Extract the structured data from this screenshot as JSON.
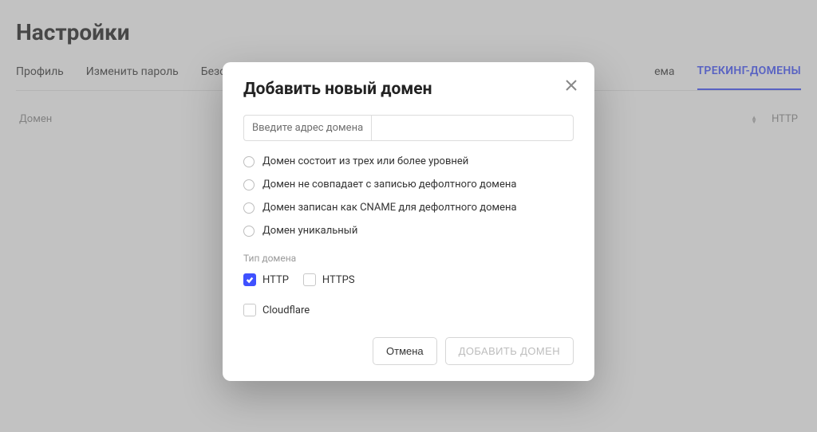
{
  "page": {
    "title": "Настройки"
  },
  "tabs": [
    "Профиль",
    "Изменить пароль",
    "Безопасность",
    "ема",
    "ТРЕКИНГ-ДОМЕНЫ"
  ],
  "table": {
    "col_domain": "Домен",
    "col_http": "HTTP"
  },
  "modal": {
    "title": "Добавить новый домен",
    "input_prefix": "Введите адрес домена",
    "input_value": "",
    "checks": [
      "Домен состоит из трех или более уровней",
      "Домен не совпадает с записью дефолтного домена",
      "Домен записан как CNAME для дефолтного домена",
      "Домен уникальный"
    ],
    "type_label": "Тип домена",
    "protocols": {
      "http": "HTTP",
      "https": "HTTPS"
    },
    "cloudflare": "Cloudflare",
    "buttons": {
      "cancel": "Отмена",
      "submit": "ДОБАВИТЬ ДОМЕН"
    }
  }
}
